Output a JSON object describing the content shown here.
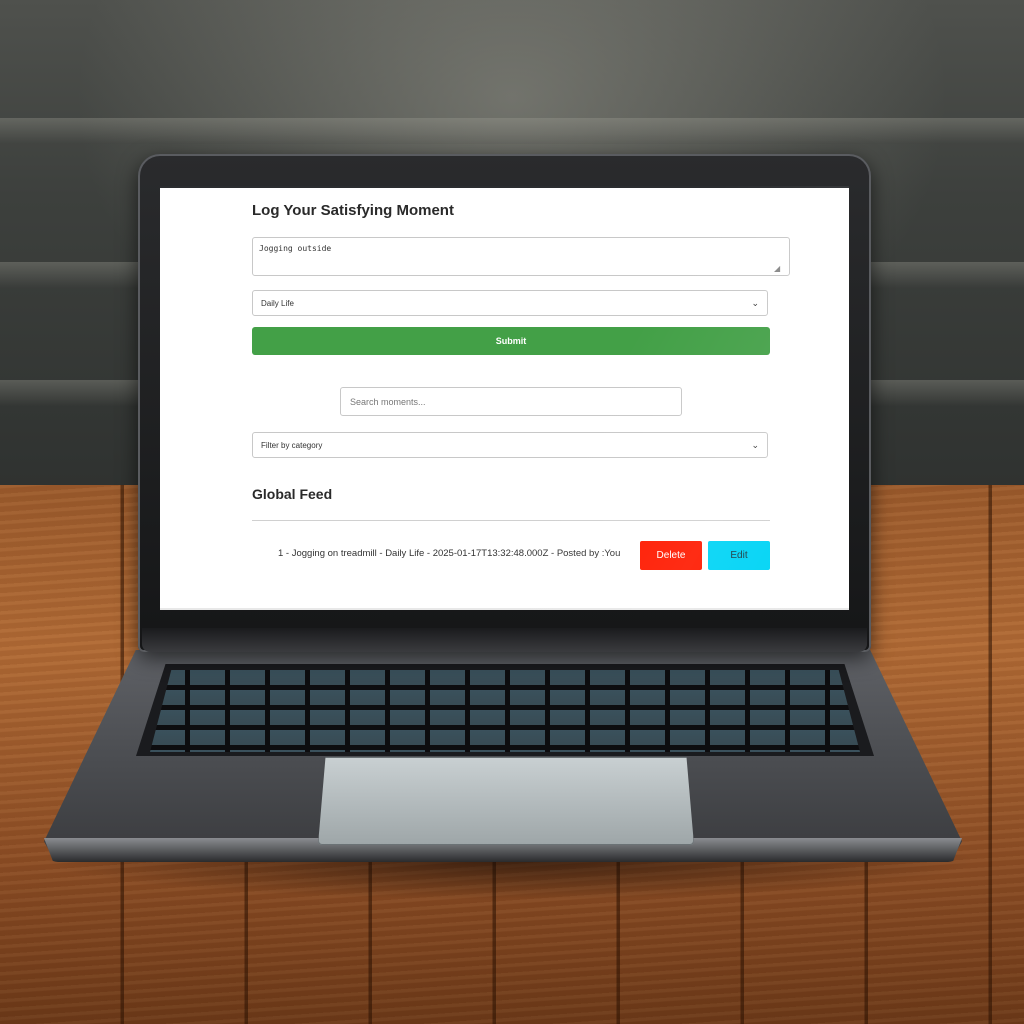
{
  "form": {
    "title": "Log Your Satisfying Moment",
    "moment_value": "Jogging outside",
    "category_selected": "Daily Life",
    "submit_label": "Submit"
  },
  "search": {
    "placeholder": "Search moments..."
  },
  "filter": {
    "selected": "Filter by category"
  },
  "feed": {
    "title": "Global Feed",
    "items": [
      {
        "text": "1 - Jogging on treadmill - Daily Life - 2025-01-17T13:32:48.000Z - Posted by :You",
        "delete_label": "Delete",
        "edit_label": "Edit"
      }
    ]
  },
  "colors": {
    "submit": "#43a047",
    "delete": "#ff1a00",
    "edit": "#00d4f5"
  },
  "icons": {
    "dropdown": "chevron-down-icon",
    "textarea_resize": "resize-handle-icon"
  }
}
